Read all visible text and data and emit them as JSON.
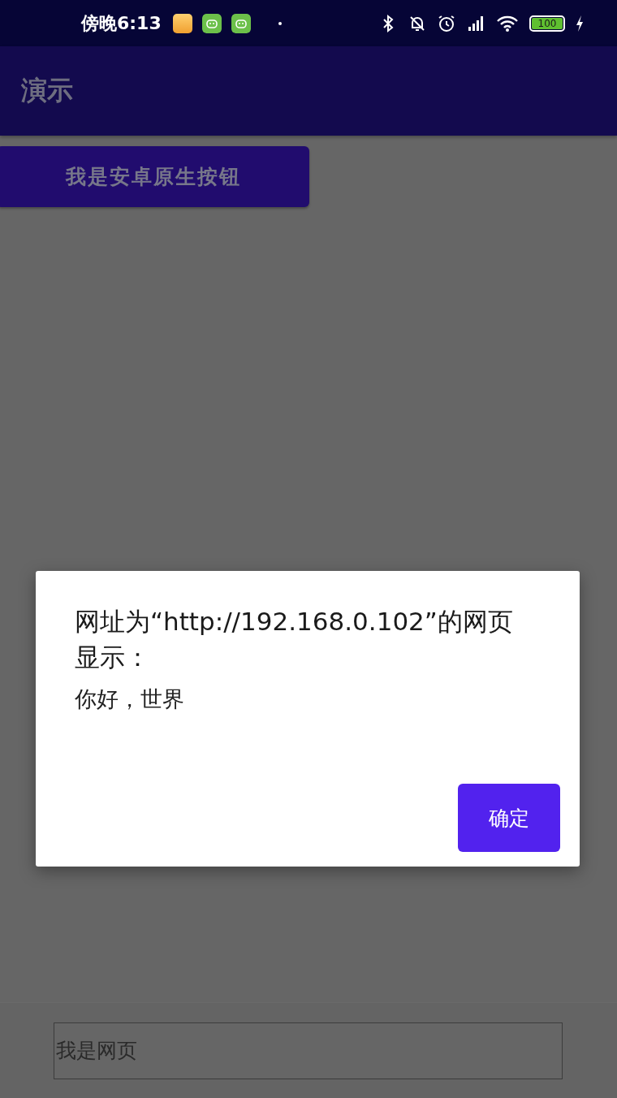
{
  "status_bar": {
    "time": "傍晚6:13",
    "battery": "100"
  },
  "app_bar": {
    "title": "演示"
  },
  "native_button": {
    "label": "我是安卓原生按钮"
  },
  "webview": {
    "text_field": {
      "value": "我是网页"
    }
  },
  "dialog": {
    "title": "网址为“http://192.168.0.102”的网页显示：",
    "message": "你好，世界",
    "buttons": [
      {
        "label": "确定"
      }
    ]
  }
}
